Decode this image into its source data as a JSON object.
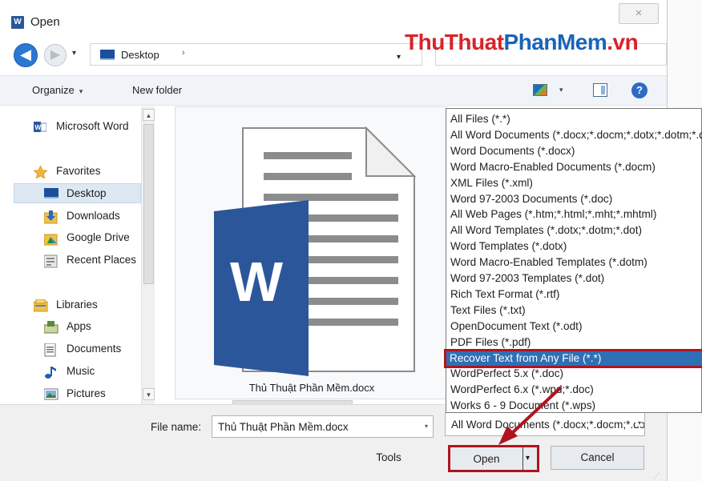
{
  "window": {
    "title": "Open",
    "app_icon_letter": "W",
    "close_glyph": "✕"
  },
  "nav": {
    "back_glyph": "◀",
    "forward_glyph": "▶",
    "history_glyph": "▾",
    "address_text": "Desktop",
    "address_chevron": "›",
    "address_drop": "▾"
  },
  "watermark": {
    "part1": "ThuThuat",
    "part2": "PhanMem",
    "part3": ".vn"
  },
  "toolbar": {
    "organize_label": "Organize",
    "caret": "▾",
    "new_folder_label": "New folder",
    "help_glyph": "?"
  },
  "sidebar": {
    "items": [
      {
        "label": "Microsoft Word",
        "icon": "word-icon"
      },
      {
        "label": "Favorites",
        "icon": "star-icon"
      },
      {
        "label": "Desktop",
        "icon": "desktop-icon",
        "selected": true
      },
      {
        "label": "Downloads",
        "icon": "downloads-icon"
      },
      {
        "label": "Google Drive",
        "icon": "google-drive-icon"
      },
      {
        "label": "Recent Places",
        "icon": "recent-places-icon"
      },
      {
        "label": "Libraries",
        "icon": "libraries-icon"
      },
      {
        "label": "Apps",
        "icon": "apps-icon"
      },
      {
        "label": "Documents",
        "icon": "documents-icon"
      },
      {
        "label": "Music",
        "icon": "music-icon"
      },
      {
        "label": "Pictures",
        "icon": "pictures-icon"
      }
    ],
    "scroll_up": "▲",
    "scroll_down": "▼"
  },
  "preview": {
    "file_name": "Thủ Thuật Phần Mềm.docx",
    "logo_letter": "W"
  },
  "bottom": {
    "file_name_label": "File name:",
    "file_name_value": "Thủ Thuật Phần Mềm.docx",
    "file_type_value": "All Word Documents (*.docx;*.docm;*.dotx;*.dotm)",
    "tools_label": "Tools",
    "tools_caret": "▾",
    "open_label": "Open",
    "cancel_label": "Cancel",
    "drop_glyph": "▾"
  },
  "file_types": [
    "All Files (*.*)",
    "All Word Documents (*.docx;*.docm;*.dotx;*.dotm;*.doc;*.dot;*.htm;*.html;*.rtf;*.mht;*.mhtml;*.xml;*.odt;*.pdf)",
    "Word Documents (*.docx)",
    "Word Macro-Enabled Documents (*.docm)",
    "XML Files (*.xml)",
    "Word 97-2003 Documents (*.doc)",
    "All Web Pages (*.htm;*.html;*.mht;*.mhtml)",
    "All Word Templates (*.dotx;*.dotm;*.dot)",
    "Word Templates (*.dotx)",
    "Word Macro-Enabled Templates (*.dotm)",
    "Word 97-2003 Templates (*.dot)",
    "Rich Text Format (*.rtf)",
    "Text Files (*.txt)",
    "OpenDocument Text (*.odt)",
    "PDF Files (*.pdf)",
    "Recover Text from Any File (*.*)",
    "WordPerfect 5.x (*.doc)",
    "WordPerfect 6.x (*.wpd;*.doc)",
    "Works 6 - 9 Document (*.wps)"
  ],
  "highlighted_file_type_index": 15,
  "colors": {
    "highlight_fill": "#2f6fb5",
    "annotation_red": "#b0141f",
    "word_blue": "#2b579a"
  }
}
